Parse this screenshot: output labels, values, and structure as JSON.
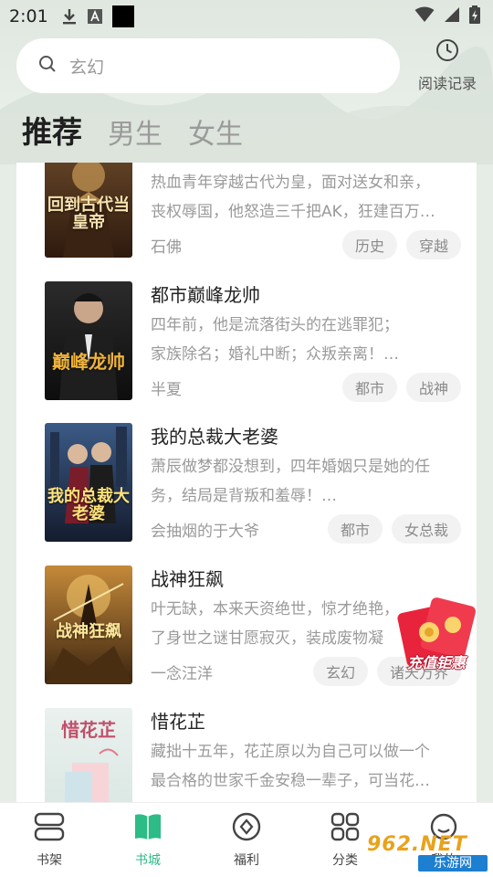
{
  "status_bar": {
    "time": "2:01"
  },
  "search": {
    "placeholder": "玄幻"
  },
  "history": {
    "label": "阅读记录"
  },
  "tabs": [
    {
      "label": "推荐",
      "active": true
    },
    {
      "label": "男生",
      "active": false
    },
    {
      "label": "女生",
      "active": false
    }
  ],
  "books": [
    {
      "title": "",
      "desc_line1": "热血青年穿越古代为皇，面对送女和亲，",
      "desc_line2": "丧权辱国，他怒造三千把AK，狂建百万…",
      "author": "石佛",
      "tags": [
        "历史",
        "穿越"
      ],
      "cover_text": "回到古代当皇帝"
    },
    {
      "title": "都市巅峰龙帅",
      "desc_line1": "四年前，他是流落街头的在逃罪犯；",
      "desc_line2": "家族除名；婚礼中断；众叛亲离！…",
      "author": "半夏",
      "tags": [
        "都市",
        "战神"
      ],
      "cover_text": "巅峰龙帅"
    },
    {
      "title": "我的总裁大老婆",
      "desc_line1": "萧辰做梦都没想到，四年婚姻只是她的任",
      "desc_line2": "务，结局是背叛和羞辱！…",
      "author": "会抽烟的于大爷",
      "tags": [
        "都市",
        "女总裁"
      ],
      "cover_text": "我的总裁大老婆"
    },
    {
      "title": "战神狂飙",
      "desc_line1": "叶无缺，本来天资绝世，惊才绝艳，",
      "desc_line2": "了身世之谜甘愿寂灭，装成废物凝",
      "author": "一念汪洋",
      "tags": [
        "玄幻",
        "诸天万界"
      ],
      "cover_text": "战神狂飙"
    },
    {
      "title": "惜花芷",
      "desc_line1": "藏拙十五年，花芷原以为自己可以做一个",
      "desc_line2": "最合格的世家千金安稳一辈子，可当花…",
      "author": "",
      "tags": [],
      "cover_text": "惜花芷"
    }
  ],
  "promo": {
    "label": "充值钜惠"
  },
  "tabbar": [
    {
      "label": "书架",
      "icon": "bookshelf-icon",
      "active": false
    },
    {
      "label": "书城",
      "icon": "book-city-icon",
      "active": true
    },
    {
      "label": "福利",
      "icon": "welfare-icon",
      "active": false
    },
    {
      "label": "分类",
      "icon": "category-icon",
      "active": false
    },
    {
      "label": "我的",
      "icon": "profile-icon",
      "active": false
    }
  ],
  "watermark": {
    "line1": "962.NET",
    "line2": "乐游网"
  },
  "colors": {
    "accent": "#2dbb86",
    "background": "#e6ece6",
    "promo_red": "#e8243c"
  }
}
